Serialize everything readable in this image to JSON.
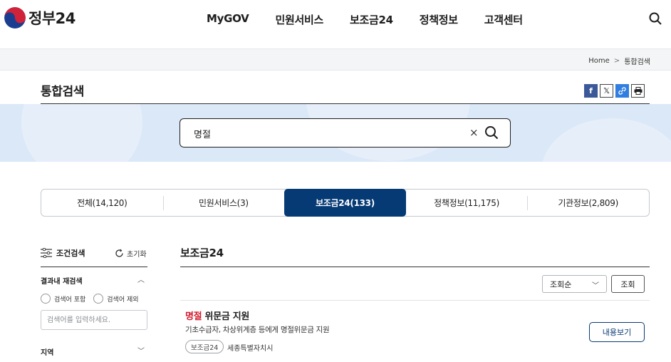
{
  "header": {
    "logo_text": "정부24",
    "nav": [
      "MyGOV",
      "민원서비스",
      "보조금24",
      "정책정보",
      "고객센터"
    ]
  },
  "breadcrumb": {
    "home": "Home",
    "sep": ">",
    "current": "통합검색"
  },
  "page": {
    "title": "통합검색"
  },
  "search": {
    "query": "명절",
    "clear": "×"
  },
  "tabs": [
    {
      "label": "전체(14,120)",
      "active": false
    },
    {
      "label": "민원서비스(3)",
      "active": false
    },
    {
      "label": "보조금24(133)",
      "active": true
    },
    {
      "label": "정책정보(11,175)",
      "active": false
    },
    {
      "label": "기관정보(2,809)",
      "active": false
    }
  ],
  "sidebar": {
    "title": "조건검색",
    "reset": "초기화",
    "refine_title": "결과내 재검색",
    "include_label": "검색어 포함",
    "exclude_label": "검색어 제외",
    "input_placeholder": "검색어를 입력하세요.",
    "region_title": "지역"
  },
  "main": {
    "heading": "보조금24",
    "sort_value": "조회순",
    "query_button": "조회",
    "result": {
      "title_highlight": "명절",
      "title_rest": " 위문금 지원",
      "description": "기초수급자, 차상위계층 등에게 명절위문금 지원",
      "tag": "보조금24",
      "org": "세종특별자치시",
      "detail_button": "내용보기"
    }
  },
  "colors": {
    "primary": "#063a74",
    "highlight": "#d4192c",
    "band": "#dbe8f7"
  }
}
